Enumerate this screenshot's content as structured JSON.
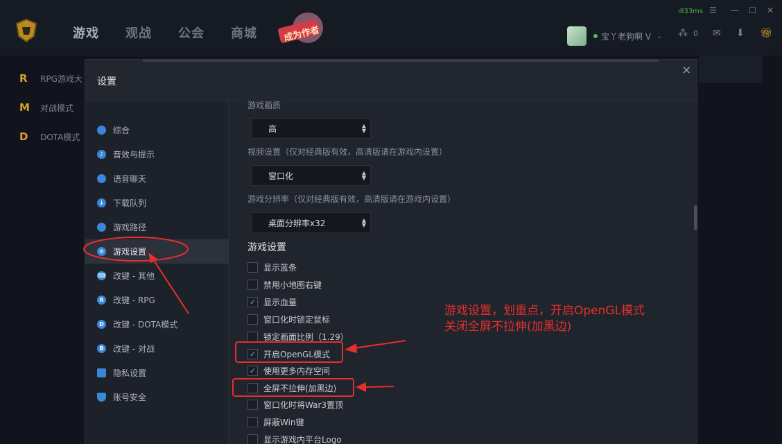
{
  "topbar": {
    "nav": [
      "游戏",
      "观战",
      "公会",
      "商城"
    ],
    "sticker_text": "成为作者",
    "ping": "ıll33ms",
    "username": "宝丫老狗啊 V",
    "friend_count": "0"
  },
  "bg_nav": [
    {
      "icon": "R",
      "label": "RPG游戏大"
    },
    {
      "icon": "M",
      "label": "对战模式"
    },
    {
      "icon": "D",
      "label": "DOTA模式"
    }
  ],
  "dialog": {
    "title": "设置",
    "close": "×",
    "sidebar": [
      {
        "label": "综合",
        "icon": "pie-chart-icon"
      },
      {
        "label": "音效与提示",
        "icon": "bell-icon"
      },
      {
        "label": "语音聊天",
        "icon": "microphone-icon"
      },
      {
        "label": "下载队列",
        "icon": "cloud-download-icon"
      },
      {
        "label": "游戏路径",
        "icon": "mouse-icon"
      },
      {
        "label": "游戏设置",
        "icon": "gear-icon",
        "active": true
      },
      {
        "label": "改键 - 其他",
        "icon": "keyboard-icon"
      },
      {
        "label": "改键 - RPG",
        "icon": "r-icon"
      },
      {
        "label": "改键 - DOTA模式",
        "icon": "d-icon"
      },
      {
        "label": "改键 - 对战",
        "icon": "b-icon"
      },
      {
        "label": "隐私设置",
        "icon": "lock-icon"
      },
      {
        "label": "账号安全",
        "icon": "shield-icon"
      }
    ],
    "content": {
      "quality_label": "游戏画质",
      "quality_value": "高",
      "video_label": "视频设置（仅对经典版有效，高清版请在游戏内设置）",
      "video_value": "窗口化",
      "resolution_label": "游戏分辨率（仅对经典版有效，高清版请在游戏内设置）",
      "resolution_value": "桌面分辨率x32",
      "section_title": "游戏设置",
      "checkboxes": [
        {
          "label": "显示蓝条",
          "checked": false
        },
        {
          "label": "禁用小地图右键",
          "checked": false
        },
        {
          "label": "显示血量",
          "checked": true
        },
        {
          "label": "窗口化时锁定鼠标",
          "checked": false
        },
        {
          "label": "锁定画面比例（1.29）",
          "checked": false
        },
        {
          "label": "开启OpenGL模式",
          "checked": true
        },
        {
          "label": "使用更多内存空间",
          "checked": true
        },
        {
          "label": "全屏不拉伸(加黑边)",
          "checked": false
        },
        {
          "label": "窗口化时将War3置顶",
          "checked": false
        },
        {
          "label": "屏蔽Win键",
          "checked": false
        },
        {
          "label": "显示游戏内平台Logo",
          "checked": false
        }
      ]
    }
  },
  "annotation": {
    "line1": "游戏设置，划重点，开启OpenGL模式",
    "line2": "关闭全屏不拉伸(加黑边)",
    "color": "#e5302a"
  }
}
